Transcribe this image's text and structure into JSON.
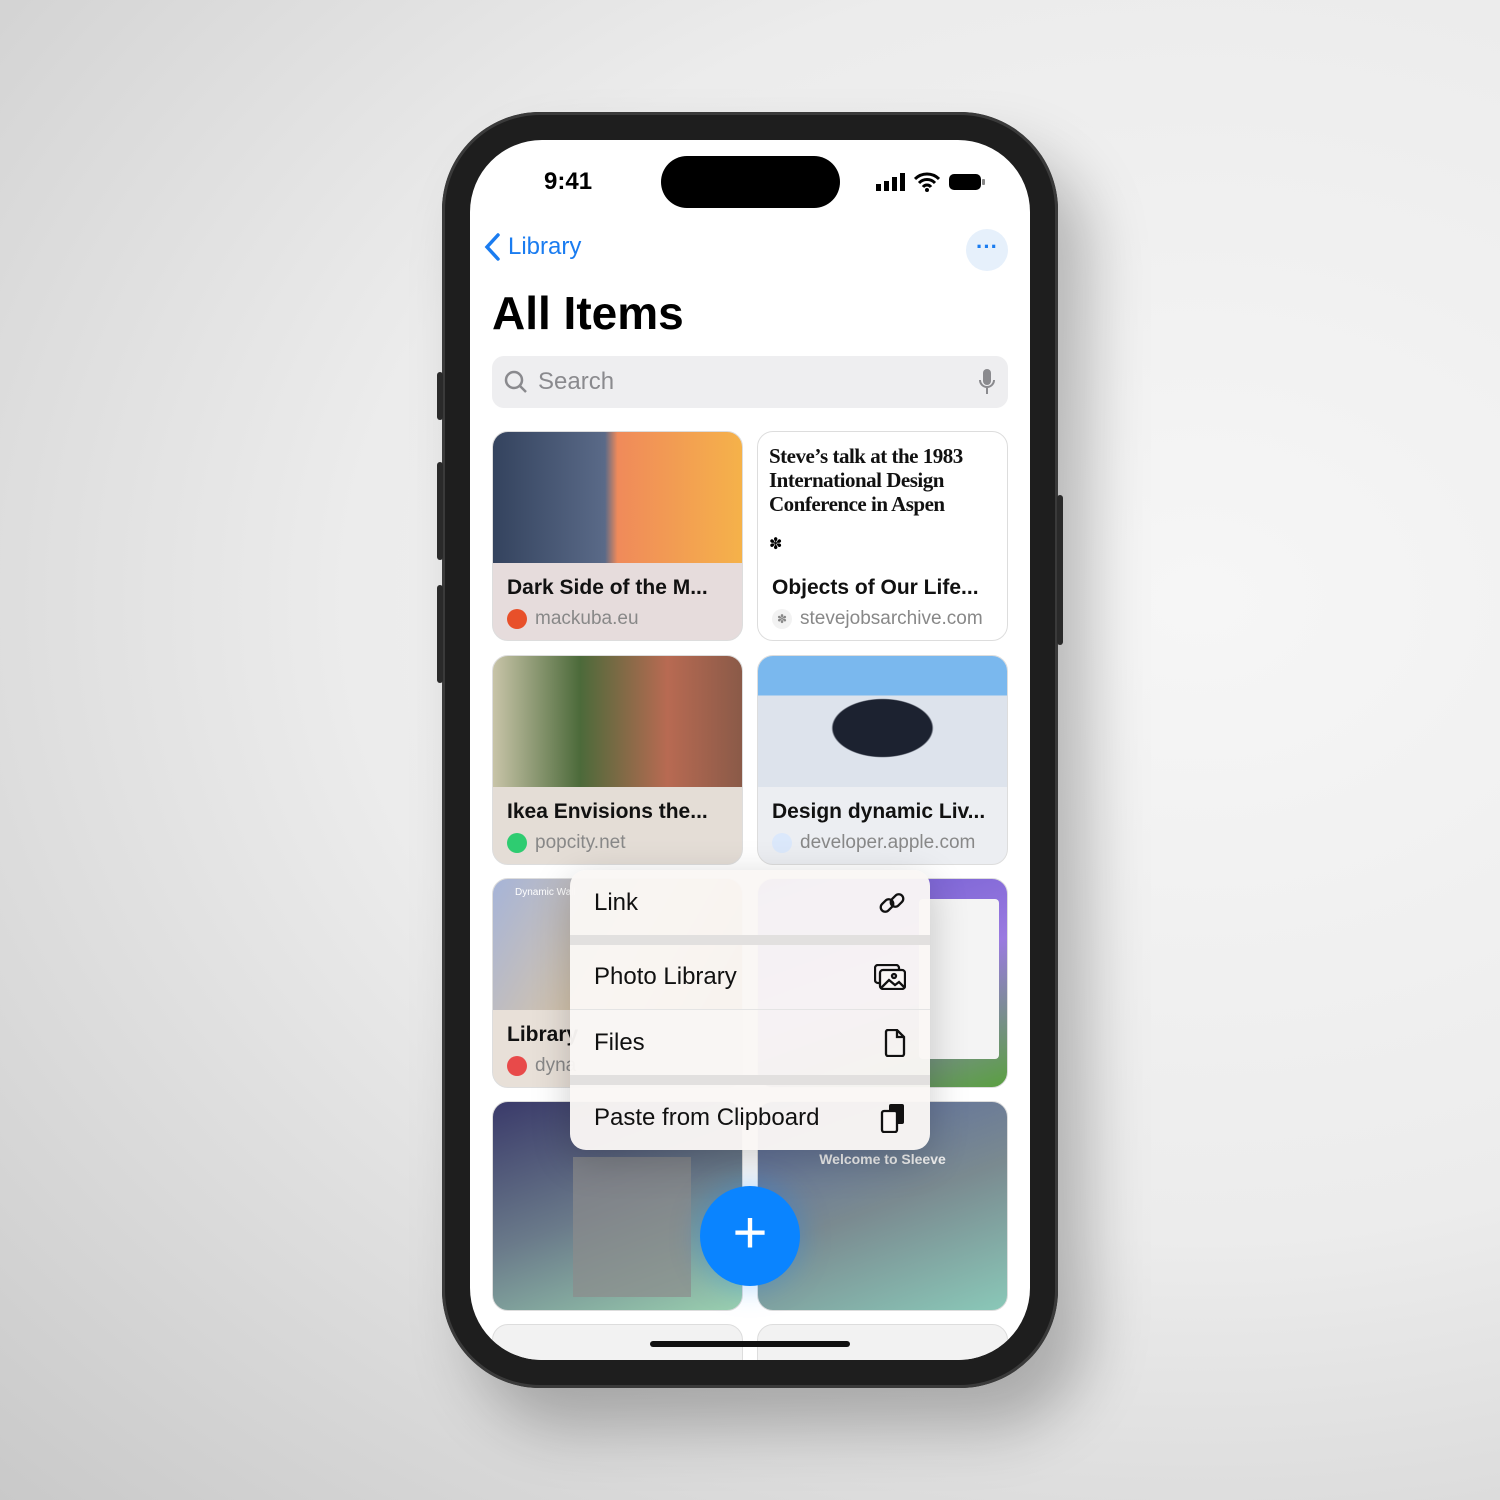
{
  "status": {
    "time": "9:41"
  },
  "nav": {
    "back_label": "Library",
    "more_icon": "ellipsis-icon"
  },
  "page": {
    "title": "All Items"
  },
  "search": {
    "placeholder": "Search"
  },
  "cards": [
    {
      "title": "Dark Side of the M...",
      "source": "mackuba.eu"
    },
    {
      "headline": "Steve’s talk at the 1983 International Design Conference in Aspen",
      "title": "Objects of Our Life...",
      "source": "stevejobsarchive.com"
    },
    {
      "title": "Ikea Envisions the...",
      "source": "popcity.net"
    },
    {
      "title": "Design dynamic Liv...",
      "source": "developer.apple.com"
    },
    {
      "title": "Library",
      "source": "dyna",
      "overlay": "Dynamic Wall"
    },
    {
      "title": "",
      "source": ""
    },
    {
      "title": "",
      "source": ""
    },
    {
      "title": "",
      "source": "",
      "overlay": "Welcome to Sleeve"
    }
  ],
  "menu": {
    "items": [
      {
        "label": "Link",
        "icon": "link-icon"
      },
      {
        "label": "Photo Library",
        "icon": "photo-library-icon"
      },
      {
        "label": "Files",
        "icon": "document-icon"
      },
      {
        "label": "Paste from Clipboard",
        "icon": "clipboard-icon"
      }
    ]
  },
  "fab": {
    "icon": "plus-icon",
    "label": "+"
  },
  "colors": {
    "accent": "#0a84ff",
    "link": "#1a7cf0"
  }
}
